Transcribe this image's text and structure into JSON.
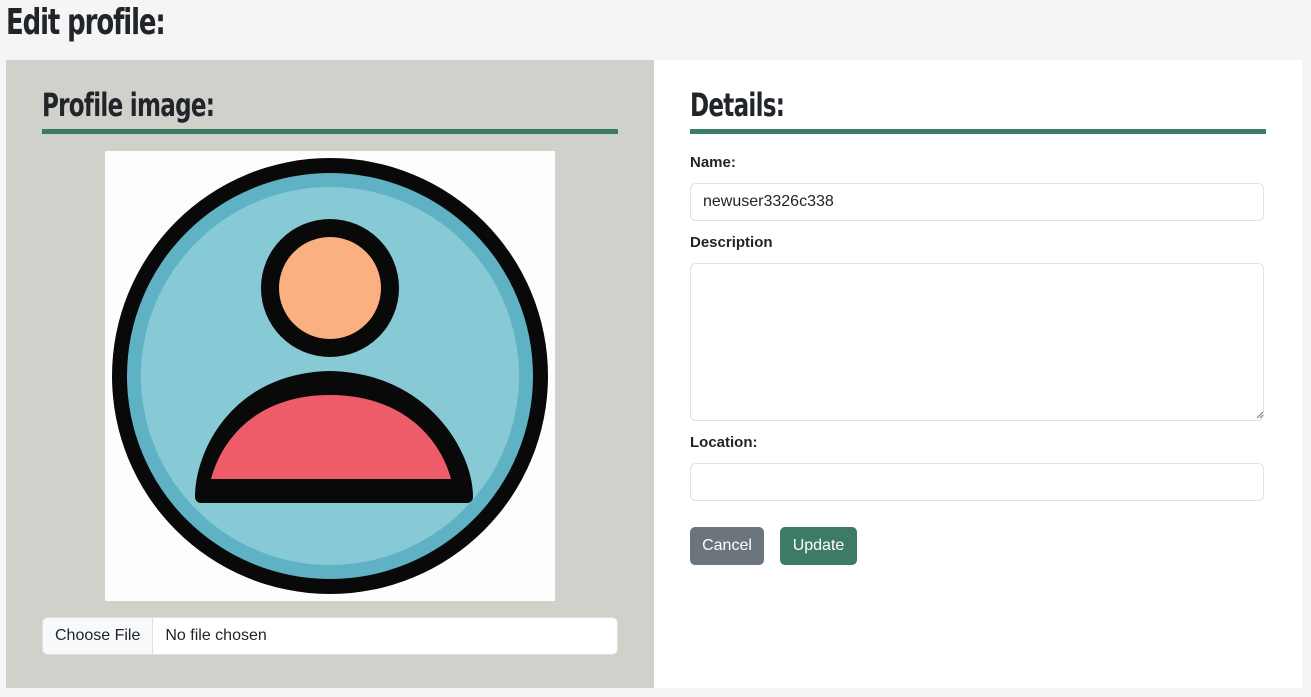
{
  "page": {
    "title": "Edit profile:"
  },
  "profile_image": {
    "heading": "Profile image:",
    "avatar_icon": "user-avatar-icon",
    "file_input": {
      "button_label": "Choose File",
      "status": "No file chosen"
    }
  },
  "details": {
    "heading": "Details:",
    "name": {
      "label": "Name:",
      "value": "newuser3326c338"
    },
    "description": {
      "label": "Description",
      "value": ""
    },
    "location": {
      "label": "Location:",
      "value": ""
    },
    "cancel_label": "Cancel",
    "update_label": "Update"
  },
  "colors": {
    "accent": "#3e7b67",
    "left_panel_bg": "#d0d1cb",
    "cancel_bg": "#6c757d"
  }
}
